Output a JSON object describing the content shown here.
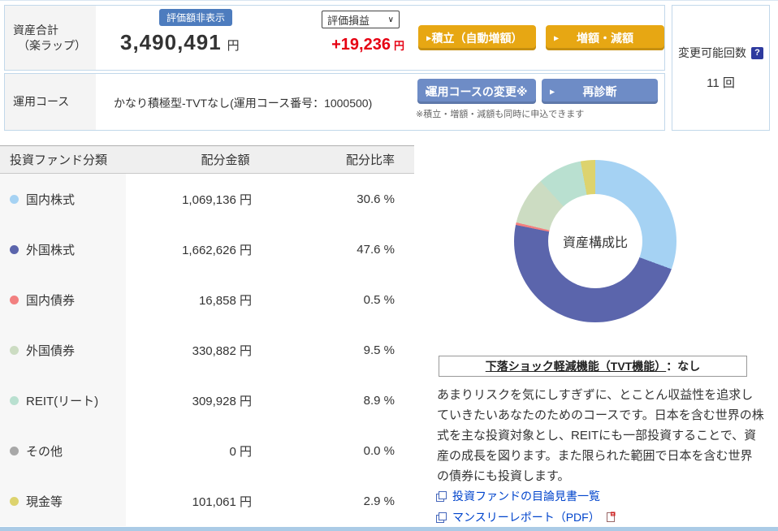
{
  "header": {
    "assets_label_line1": "資産合計",
    "assets_label_line2": "（楽ラップ）",
    "hide_badge": "評価額非表示",
    "total_amount": "3,490,491",
    "yen": "円",
    "pl_select_value": "評価損益",
    "pl_value": "+19,236",
    "btn_tsumitate": "積立（自動増額）",
    "btn_zougen": "増額・減額",
    "course_label": "運用コース",
    "course_value": "かなり積極型-TVTなし(運用コース番号：1000500)",
    "btn_course_change": "運用コースの変更※",
    "btn_rediagnosis": "再診断",
    "note": "※積立・増額・減額も同時に申込できます",
    "change_count_label": "変更可能回数",
    "change_count_value": "11 回"
  },
  "icons": {
    "button_arrow": "▶",
    "select_chevron": "∨",
    "help": "?"
  },
  "fund_table": {
    "headers": [
      "投資ファンド分類",
      "配分金額",
      "配分比率"
    ],
    "rows": [
      {
        "label": "国内株式",
        "amount": "1,069,136 円",
        "ratio": "30.6 %",
        "color": "#a5d2f3"
      },
      {
        "label": "外国株式",
        "amount": "1,662,626 円",
        "ratio": "47.6 %",
        "color": "#5b65ac"
      },
      {
        "label": "国内債券",
        "amount": "16,858 円",
        "ratio": "0.5 %",
        "color": "#f28080"
      },
      {
        "label": "外国債券",
        "amount": "330,882 円",
        "ratio": "9.5 %",
        "color": "#ccdcc2"
      },
      {
        "label": "REIT(リート)",
        "amount": "309,928 円",
        "ratio": "8.9 %",
        "color": "#b9e0d0"
      },
      {
        "label": "その他",
        "amount": "0 円",
        "ratio": "0.0 %",
        "color": "#a8a8a8"
      },
      {
        "label": "現金等",
        "amount": "101,061 円",
        "ratio": "2.9 %",
        "color": "#ddd36e"
      }
    ]
  },
  "chart_data": {
    "type": "donut",
    "title": "資産構成比",
    "categories": [
      "国内株式",
      "外国株式",
      "国内債券",
      "外国債券",
      "REIT(リート)",
      "その他",
      "現金等"
    ],
    "values": [
      30.6,
      47.6,
      0.5,
      9.5,
      8.9,
      0.0,
      2.9
    ],
    "amounts_yen": [
      1069136,
      1662626,
      16858,
      330882,
      309928,
      0,
      101061
    ],
    "colors": [
      "#a5d2f3",
      "#5b65ac",
      "#f28080",
      "#ccdcc2",
      "#b9e0d0",
      "#a8a8a8",
      "#ddd36e"
    ],
    "start_angle_deg": 0,
    "direction": "clockwise",
    "legend_position": "none",
    "center_label": "資産構成比"
  },
  "tvt": {
    "label": "下落ショック軽減機能（TVT機能）",
    "value": "：なし"
  },
  "description": "あまりリスクを気にしすぎずに、とことん収益性を追求していきたいあなたのためのコースです。日本を含む世界の株式を主な投資対象とし、REITにも一部投資することで、資産の成長を図ります。また限られた範囲で日本を含む世界の債券にも投資します。",
  "links": [
    {
      "label": "投資ファンドの目論見書一覧"
    },
    {
      "label": "マンスリーレポート（PDF）"
    }
  ],
  "colors": {
    "accent_gold": "#e7a713",
    "accent_blue_button": "#6e8cc6",
    "badge_blue": "#4d7cbe",
    "profit_red": "#e60012",
    "border_light_blue": "#c2d8ea",
    "link_blue": "#0044cc",
    "bottom_bar": "#abcbe6"
  }
}
